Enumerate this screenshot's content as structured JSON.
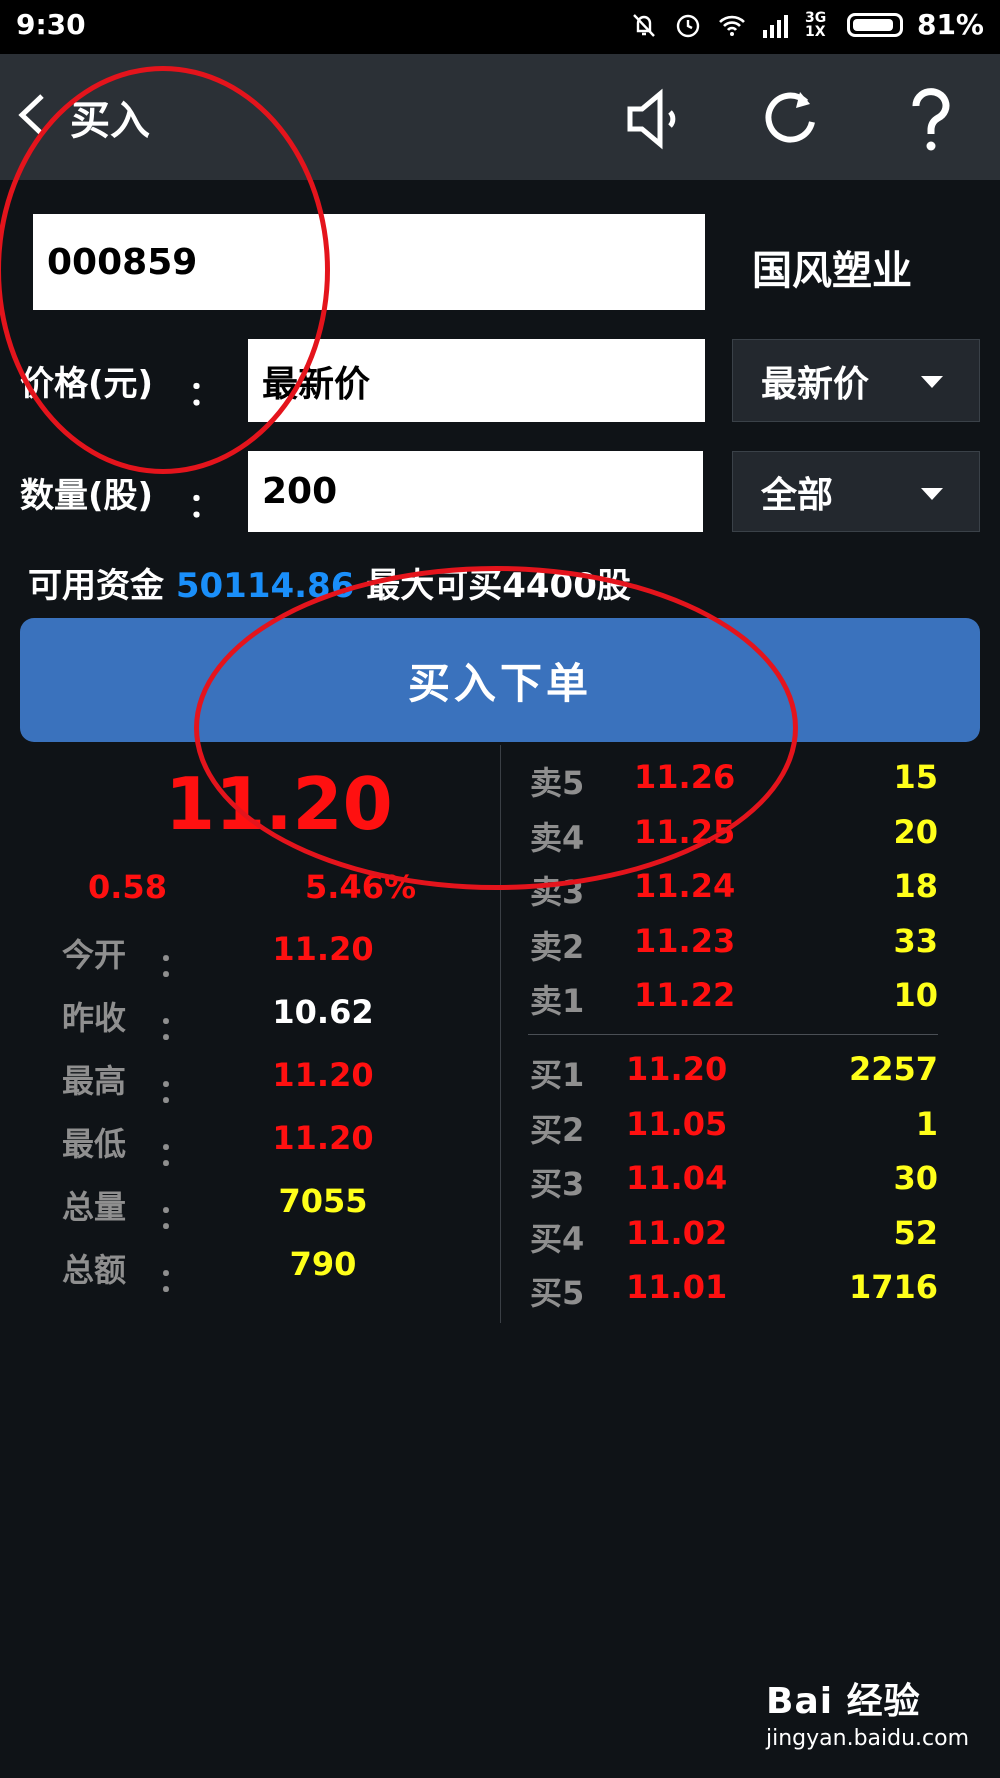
{
  "status_bar": {
    "time": "9:30",
    "network": "3G 1X",
    "battery": "81%"
  },
  "header": {
    "title": "买入",
    "icons": [
      "back-icon",
      "speaker-icon",
      "refresh-icon",
      "help-icon"
    ]
  },
  "form": {
    "stock_code": "000859",
    "stock_name": "国风塑业",
    "price_label": "价格(元)",
    "price_colon": "：",
    "price_value": "最新价",
    "price_mode": "最新价",
    "qty_label": "数量(股)",
    "qty_colon": "：",
    "qty_value": "200",
    "qty_mode": "全部"
  },
  "funds": {
    "label": "可用资金",
    "amount": "50114.86",
    "max_buy": "最大可买4400股"
  },
  "buy_button": "买入下单",
  "quote": {
    "last_price": "11.20",
    "change": "0.58",
    "change_pct": "5.46%",
    "stats": [
      {
        "label": "今开",
        "value": "11.20",
        "color": "red"
      },
      {
        "label": "昨收",
        "value": "10.62",
        "color": "white"
      },
      {
        "label": "最高",
        "value": "11.20",
        "color": "red"
      },
      {
        "label": "最低",
        "value": "11.20",
        "color": "red"
      },
      {
        "label": "总量",
        "value": "7055",
        "color": "yellow"
      },
      {
        "label": "总额",
        "value": "790",
        "color": "yellow"
      }
    ],
    "colon": "："
  },
  "orderbook": {
    "asks": [
      {
        "label": "卖5",
        "price": "11.26",
        "volume": "15"
      },
      {
        "label": "卖4",
        "price": "11.25",
        "volume": "20"
      },
      {
        "label": "卖3",
        "price": "11.24",
        "volume": "18"
      },
      {
        "label": "卖2",
        "price": "11.23",
        "volume": "33"
      },
      {
        "label": "卖1",
        "price": "11.22",
        "volume": "10"
      }
    ],
    "bids": [
      {
        "label": "买1",
        "price": "11.20",
        "volume": "2257"
      },
      {
        "label": "买2",
        "price": "11.05",
        "volume": "1"
      },
      {
        "label": "买3",
        "price": "11.04",
        "volume": "30"
      },
      {
        "label": "买4",
        "price": "11.02",
        "volume": "52"
      },
      {
        "label": "买5",
        "price": "11.01",
        "volume": "1716"
      }
    ]
  },
  "watermark": {
    "brand": "Bai 经验",
    "url": "jingyan.baidu.com"
  },
  "colors": {
    "red": "#ff1010",
    "yellow": "#ffff1a",
    "blue_button": "#3a72bd",
    "funds_blue": "#1a8ffa",
    "annotation": "#e4141c"
  }
}
